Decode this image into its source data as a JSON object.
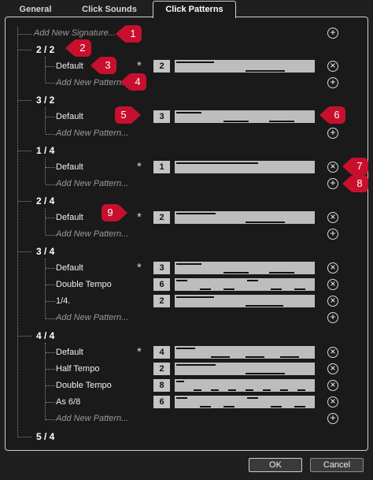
{
  "tabs": [
    "General",
    "Click Sounds",
    "Click Patterns"
  ],
  "active_tab": "Click Patterns",
  "add_signature_label": "Add New Signature...",
  "add_pattern_label": "Add New Pattern...",
  "default_marker": "*",
  "signatures": [
    {
      "name": "2 / 2",
      "patterns": [
        {
          "name": "Default",
          "count": "2",
          "default": true
        }
      ]
    },
    {
      "name": "3 / 2",
      "patterns": [
        {
          "name": "Default",
          "count": "3",
          "default": false
        }
      ]
    },
    {
      "name": "1 / 4",
      "patterns": [
        {
          "name": "Default",
          "count": "1",
          "default": true
        }
      ]
    },
    {
      "name": "2 / 4",
      "patterns": [
        {
          "name": "Default",
          "count": "2",
          "default": true
        }
      ]
    },
    {
      "name": "3 / 4",
      "patterns": [
        {
          "name": "Default",
          "count": "3",
          "default": true
        },
        {
          "name": "Double Tempo",
          "count": "6",
          "default": false
        },
        {
          "name": "1/4.",
          "count": "2",
          "default": false
        }
      ]
    },
    {
      "name": "4 / 4",
      "patterns": [
        {
          "name": "Default",
          "count": "4",
          "default": true
        },
        {
          "name": "Half Tempo",
          "count": "2",
          "default": false
        },
        {
          "name": "Double Tempo",
          "count": "8",
          "default": false
        },
        {
          "name": "As 6/8",
          "count": "6",
          "default": false
        }
      ]
    },
    {
      "name": "5 / 4",
      "patterns": []
    }
  ],
  "callouts": [
    "1",
    "2",
    "3",
    "4",
    "5",
    "6",
    "7",
    "8",
    "9"
  ],
  "buttons": {
    "ok": "OK",
    "cancel": "Cancel"
  },
  "colors": {
    "callout": "#c8102e",
    "background": "#1a1a1a",
    "pattern_box": "#bdbdbd"
  },
  "icons": {
    "remove": "remove-circle-icon",
    "add": "add-circle-icon"
  }
}
